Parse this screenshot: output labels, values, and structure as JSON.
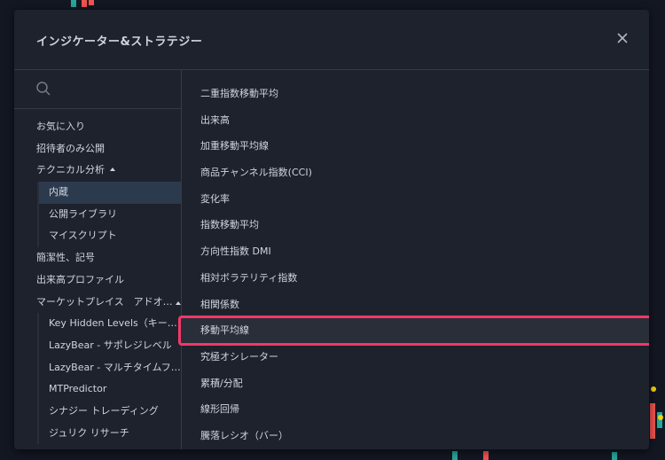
{
  "dialog": {
    "title": "インジケーター&ストラテジー"
  },
  "search": {
    "placeholder": ""
  },
  "sidebar": {
    "items": [
      {
        "label": "お気に入り"
      },
      {
        "label": "招待者のみ公開"
      },
      {
        "label": "テクニカル分析"
      },
      {
        "label": "内蔵"
      },
      {
        "label": "公開ライブラリ"
      },
      {
        "label": "マイスクリプト"
      },
      {
        "label": "簡潔性、記号"
      },
      {
        "label": "出来高プロファイル"
      },
      {
        "label": "マーケットプレイス　アドオ…"
      },
      {
        "label": "Key Hidden Levels（キー…"
      },
      {
        "label": "LazyBear - サポレジレベル"
      },
      {
        "label": "LazyBear - マルチタイムフ…"
      },
      {
        "label": "MTPredictor"
      },
      {
        "label": "シナジー トレーディング"
      },
      {
        "label": "ジュリク リサーチ"
      }
    ]
  },
  "indicators": {
    "items": [
      {
        "label": "二重指数移動平均"
      },
      {
        "label": "出来高"
      },
      {
        "label": "加重移動平均線"
      },
      {
        "label": "商品チャンネル指数(CCI)"
      },
      {
        "label": "変化率"
      },
      {
        "label": "指数移動平均"
      },
      {
        "label": "方向性指数 DMI"
      },
      {
        "label": "相対ボラテリティ指数"
      },
      {
        "label": "相関係数"
      },
      {
        "label": "移動平均線"
      },
      {
        "label": "究極オシレーター"
      },
      {
        "label": "累積/分配"
      },
      {
        "label": "線形回帰"
      },
      {
        "label": "騰落レシオ（バー）"
      }
    ]
  },
  "colors": {
    "highlight_border": "#f23868",
    "active_bg": "#2b3a4d",
    "panel_bg": "#1e222d"
  },
  "icons": {
    "search": "search-icon",
    "close": "close-icon",
    "caret": "caret-up-icon"
  }
}
